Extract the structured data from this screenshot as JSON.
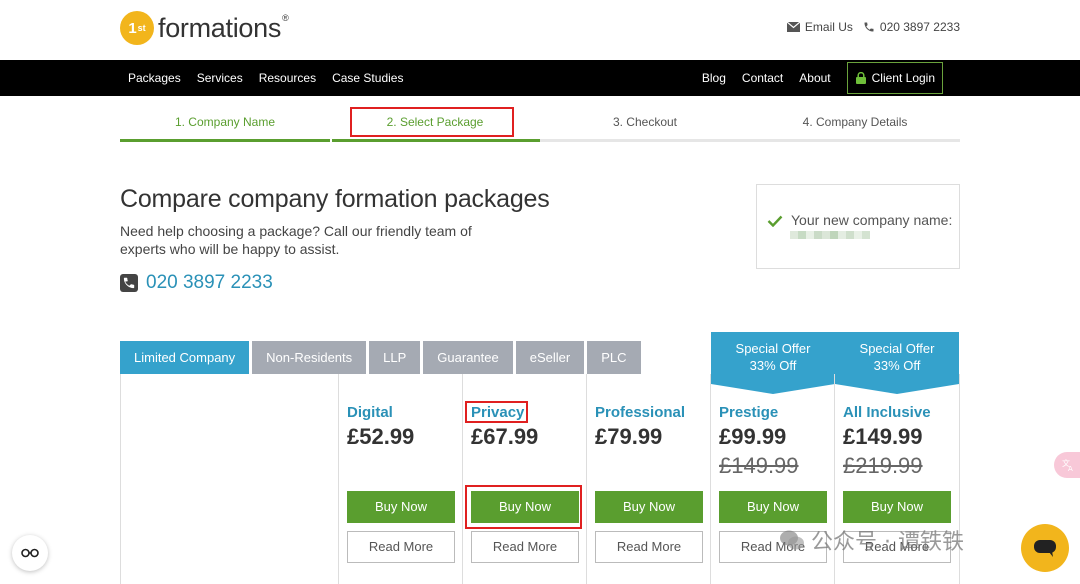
{
  "header": {
    "logo_number": "1",
    "logo_suffix": "st",
    "logo_word": "formations",
    "logo_reg": "®",
    "email_label": "Email Us",
    "phone": "020 3897 2233"
  },
  "nav": {
    "left": [
      "Packages",
      "Services",
      "Resources",
      "Case Studies"
    ],
    "right": [
      "Blog",
      "Contact",
      "About"
    ],
    "login": "Client Login"
  },
  "steps": [
    {
      "label": "1. Company Name",
      "state": "done"
    },
    {
      "label": "2. Select Package",
      "state": "done"
    },
    {
      "label": "3. Checkout",
      "state": "todo"
    },
    {
      "label": "4. Company Details",
      "state": "todo"
    }
  ],
  "page": {
    "title": "Compare company formation packages",
    "subtitle": "Need help choosing a package? Call our friendly team of experts who will be happy to assist.",
    "phone": "020 3897 2233",
    "company_name_label": "Your new company name:"
  },
  "tabs": [
    "Limited Company",
    "Non-Residents",
    "LLP",
    "Guarantee",
    "eSeller",
    "PLC"
  ],
  "packages": [
    {
      "name": "Digital",
      "price": "£52.99",
      "old_price": "",
      "offer_line1": "",
      "offer_line2": "",
      "buy": "Buy Now",
      "read": "Read More"
    },
    {
      "name": "Privacy",
      "price": "£67.99",
      "old_price": "",
      "offer_line1": "",
      "offer_line2": "",
      "buy": "Buy Now",
      "read": "Read More"
    },
    {
      "name": "Professional",
      "price": "£79.99",
      "old_price": "",
      "offer_line1": "",
      "offer_line2": "",
      "buy": "Buy Now",
      "read": "Read More"
    },
    {
      "name": "Prestige",
      "price": "£99.99",
      "old_price": "£149.99",
      "offer_line1": "Special Offer",
      "offer_line2": "33% Off",
      "buy": "Buy Now",
      "read": "Read More"
    },
    {
      "name": "All Inclusive",
      "price": "£149.99",
      "old_price": "£219.99",
      "offer_line1": "Special Offer",
      "offer_line2": "33% Off",
      "buy": "Buy Now",
      "read": "Read More"
    }
  ],
  "watermark": "公众号 · 谭铁铁",
  "colors": {
    "brand_yellow": "#f2b51c",
    "brand_green": "#5a9e2f",
    "brand_blue": "#35a2cc",
    "highlight_red": "#e02020"
  }
}
